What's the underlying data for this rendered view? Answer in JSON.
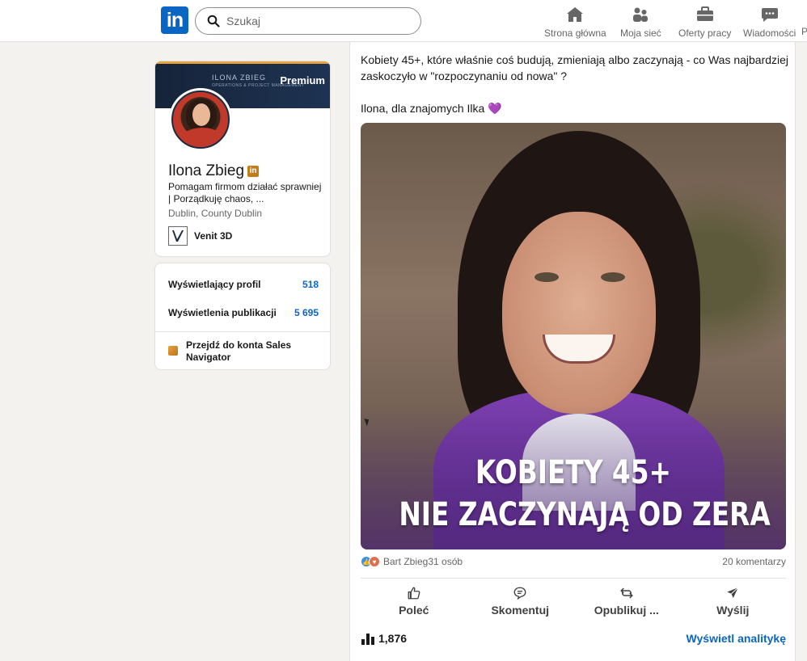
{
  "nav": {
    "logo": "in",
    "search_placeholder": "Szukaj",
    "items": [
      {
        "label": "Strona główna",
        "icon": "home-icon"
      },
      {
        "label": "Moja sieć",
        "icon": "network-icon"
      },
      {
        "label": "Oferty pracy",
        "icon": "briefcase-icon"
      },
      {
        "label": "Wiadomości",
        "icon": "messaging-icon"
      }
    ],
    "clipped": "P"
  },
  "profile": {
    "banner_name": "ILONA ZBIEG",
    "banner_tagline": "OPERATIONS & PROJECT MANAGEMENT",
    "premium_label": "Premium",
    "name": "Ilona Zbieg",
    "headline": "Pomagam firmom działać sprawniej | Porządkuję chaos, ...",
    "location": "Dublin, County Dublin",
    "company": "Venit 3D"
  },
  "stats": {
    "profile_viewers_label": "Wyświetlający profil",
    "profile_viewers_value": "518",
    "post_impressions_label": "Wyświetlenia publikacji",
    "post_impressions_value": "5 695",
    "sales_navigator": "Przejdź do konta Sales Navigator"
  },
  "post": {
    "text_line1": "Kobiety 45+, które właśnie coś budują, zmieniają albo zaczynają - co Was najbardziej zaskoczyło w  \"rozpoczynaniu od nowa\" ?",
    "text_line2": "Ilona, dla znajomych Ilka 💜",
    "image_headline_1": "KOBIETY 45+",
    "image_headline_2": "NIE ZACZYNAJĄ OD ZERA",
    "reactions_names": "Bart Zbieg31 osób",
    "comments": "20 komentarzy",
    "actions": [
      {
        "label": "Poleć",
        "icon": "like-icon"
      },
      {
        "label": "Skomentuj",
        "icon": "comment-icon"
      },
      {
        "label": "Opublikuj ...",
        "icon": "repost-icon"
      },
      {
        "label": "Wyślij",
        "icon": "send-icon"
      }
    ],
    "impressions": "1,876",
    "analytics_link": "Wyświetl analitykę"
  },
  "colors": {
    "brand": "#0a66c2",
    "premium": "#e7a33e",
    "background": "#f3f2ef"
  }
}
